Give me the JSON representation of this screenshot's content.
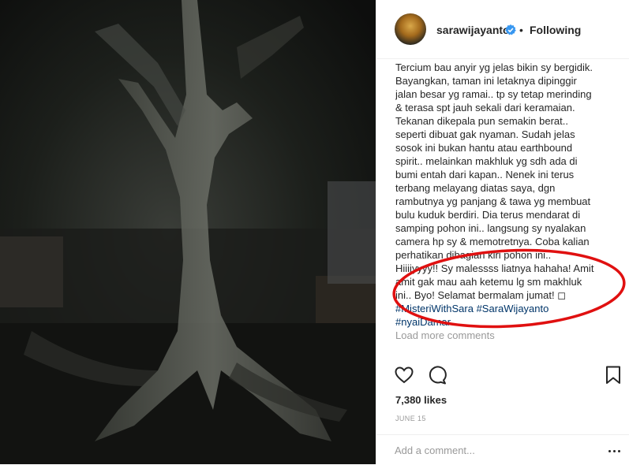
{
  "post": {
    "username": "sarawijayanto",
    "separator": "•",
    "follow_label": "Following",
    "caption_lines": [
      "Tercium bau anyir yg jelas bikin sy bergidik.",
      "Bayangkan, taman ini letaknya dipinggir",
      "jalan besar yg ramai.. tp sy tetap merinding",
      "& terasa spt jauh sekali dari keramaian.",
      "Tekanan dikepala pun semakin berat..",
      "seperti dibuat gak nyaman. Sudah jelas",
      "sosok ini bukan hantu atau earthbound",
      "spirit.. melainkan makhluk yg sdh ada di",
      "bumi entah dari kapan.. Nenek ini terus",
      "terbang melayang diatas saya, dgn",
      "rambutnya yg panjang & tawa yg membuat",
      "bulu kuduk berdiri. Dia terus mendarat di",
      "samping pohon ini.. langsung sy nyalakan",
      "camera hp sy & memotretnya. Coba kalian",
      "perhatikan dibagian kiri pohon ini..",
      "Hiiiiyyyy!! Sy malessss liatnya hahaha! Amit",
      "amit gak mau aah ketemu lg sm makhluk",
      "ini.. Byo! Selamat bermalam jumat! ◻"
    ],
    "hashtags_line1": "#MisteriWithSara #SaraWijayanto",
    "hashtags_line2": "#nyaiDamar",
    "load_more": "Load more comments",
    "likes": "7,380 likes",
    "date": "JUNE 15",
    "comment_placeholder": "Add a comment...",
    "accent_color": "#3897f0",
    "annotation_color": "#e01010",
    "icons": [
      "verified-badge-icon",
      "heart-icon",
      "comment-icon",
      "bookmark-icon",
      "more-options-icon"
    ]
  }
}
